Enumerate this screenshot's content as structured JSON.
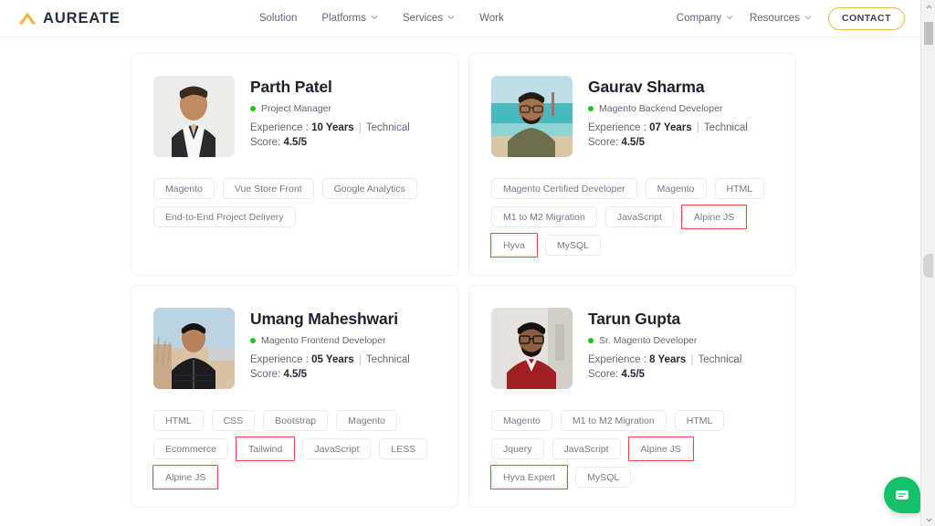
{
  "header": {
    "brand": {
      "name": "AUREATE",
      "mark_icon": "chevron-up-logo-icon",
      "mark_color": "#e9b93f"
    },
    "nav_center": [
      {
        "label": "Solution",
        "has_caret": false
      },
      {
        "label": "Platforms",
        "has_caret": true
      },
      {
        "label": "Services",
        "has_caret": true
      },
      {
        "label": "Work",
        "has_caret": false
      }
    ],
    "nav_right": [
      {
        "label": "Company",
        "has_caret": true
      },
      {
        "label": "Resources",
        "has_caret": true
      }
    ],
    "contact_label": "CONTACT",
    "contact_border_color": "#e8bb4c"
  },
  "cards": [
    {
      "name": "Parth Patel",
      "role": "Project Manager",
      "status_color": "#1fc41f",
      "experience_label": "Experience :",
      "experience_value": "10 Years",
      "separator": "|",
      "score_label": "Technical Score:",
      "score_value": "4.5/5",
      "avatar_name": "avatar-parth-patel",
      "tags": [
        {
          "label": "Magento",
          "highlight": false
        },
        {
          "label": "Vue Store Front",
          "highlight": false
        },
        {
          "label": "Google Analytics",
          "highlight": false
        },
        {
          "label": "End-to-End Project Delivery",
          "highlight": false
        }
      ]
    },
    {
      "name": "Gaurav Sharma",
      "role": "Magento Backend Developer",
      "status_color": "#1fc41f",
      "experience_label": "Experience :",
      "experience_value": "07 Years",
      "separator": "|",
      "score_label": "Technical Score:",
      "score_value": "4.5/5",
      "avatar_name": "avatar-gaurav-sharma",
      "tags": [
        {
          "label": "Magento Certified Developer",
          "highlight": false
        },
        {
          "label": "Magento",
          "highlight": false
        },
        {
          "label": "HTML",
          "highlight": false
        },
        {
          "label": "M1 to M2 Migration",
          "highlight": false
        },
        {
          "label": "JavaScript",
          "highlight": false
        },
        {
          "label": "Alpine JS",
          "highlight": true
        },
        {
          "label": "Hyva",
          "highlight": true
        },
        {
          "label": "MySQL",
          "highlight": false
        }
      ]
    },
    {
      "name": "Umang Maheshwari",
      "role": "Magento Frontend Developer",
      "status_color": "#1fc41f",
      "experience_label": "Experience :",
      "experience_value": "05 Years",
      "separator": "|",
      "score_label": "Technical Score:",
      "score_value": "4.5/5",
      "avatar_name": "avatar-umang-maheshwari",
      "tags": [
        {
          "label": "HTML",
          "highlight": false
        },
        {
          "label": "CSS",
          "highlight": false
        },
        {
          "label": "Bootstrap",
          "highlight": false
        },
        {
          "label": "Magento",
          "highlight": false
        },
        {
          "label": "Ecommerce",
          "highlight": false
        },
        {
          "label": "Tailwind",
          "highlight": true
        },
        {
          "label": "JavaScript",
          "highlight": false
        },
        {
          "label": "LESS",
          "highlight": false
        },
        {
          "label": "Alpine JS",
          "highlight": true
        }
      ]
    },
    {
      "name": "Tarun Gupta",
      "role": "Sr. Magento Developer",
      "status_color": "#1fc41f",
      "experience_label": "Experience :",
      "experience_value": "8 Years",
      "separator": "|",
      "score_label": "Technical Score:",
      "score_value": "4.5/5",
      "avatar_name": "avatar-tarun-gupta",
      "tags": [
        {
          "label": "Magento",
          "highlight": false
        },
        {
          "label": "M1 to M2 Migration",
          "highlight": false
        },
        {
          "label": "HTML",
          "highlight": false
        },
        {
          "label": "Jquery",
          "highlight": false
        },
        {
          "label": "JavaScript",
          "highlight": false
        },
        {
          "label": "Alpine JS",
          "highlight": true
        },
        {
          "label": "Hyva Expert",
          "highlight": true
        },
        {
          "label": "MySQL",
          "highlight": false
        }
      ]
    }
  ],
  "chat_widget": {
    "icon": "chat-message-icon",
    "color": "#14c16b"
  },
  "highlight_color": "#ef4444",
  "scrollbar": {
    "up_icon": "scroll-up-arrow-icon",
    "down_icon": "scroll-down-arrow-icon"
  }
}
